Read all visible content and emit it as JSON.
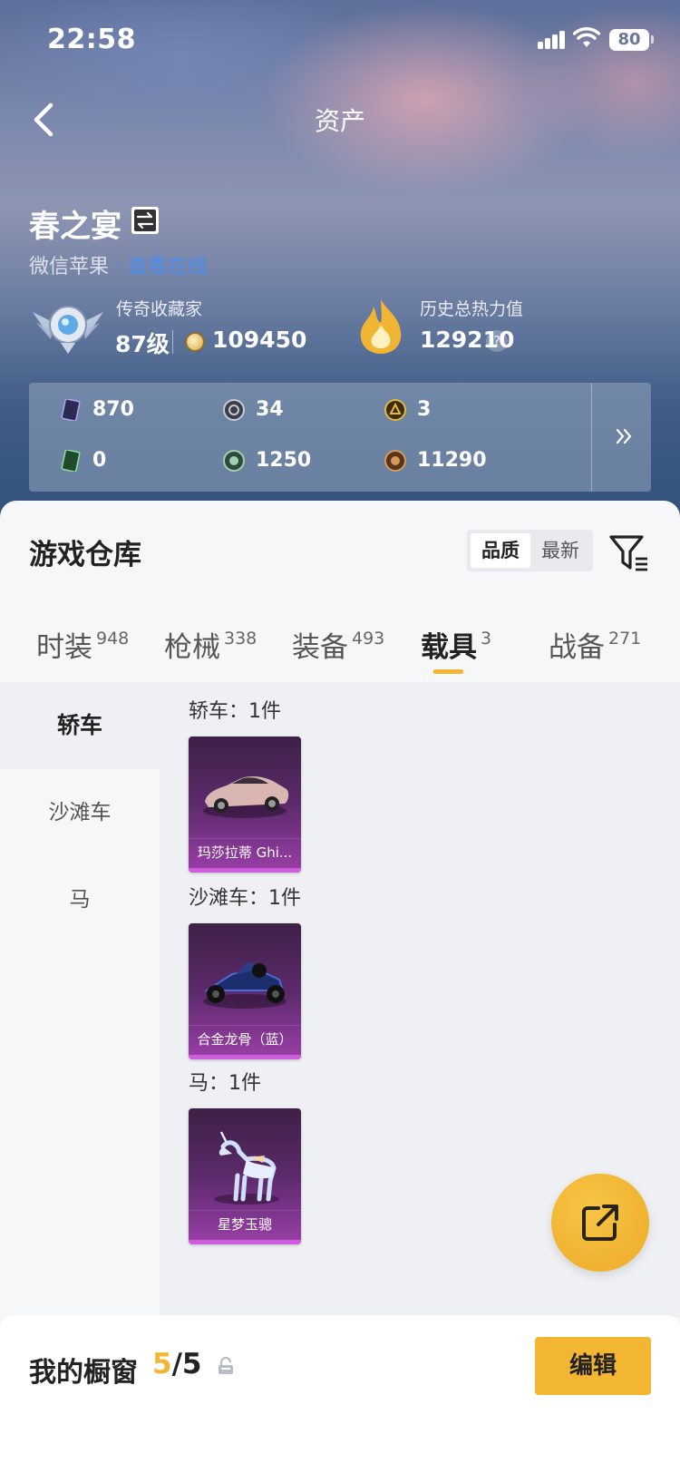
{
  "status_bar": {
    "time": "22:58",
    "battery": "80"
  },
  "nav": {
    "title": "资产"
  },
  "profile": {
    "name": "春之宴",
    "platform": "微信苹果",
    "platform_link": "· 查看在线",
    "collector_title": "传奇收藏家",
    "level": "87级",
    "points": "109450",
    "heat_title": "历史总热力值",
    "heat_value": "129210",
    "help": "?"
  },
  "currencies": [
    {
      "icon": "purple-card-icon",
      "value": "870"
    },
    {
      "icon": "silver-coin-icon",
      "value": "34"
    },
    {
      "icon": "gold-medal-icon",
      "value": "3"
    },
    {
      "icon": "green-card-icon",
      "value": "0"
    },
    {
      "icon": "green-coin-icon",
      "value": "1250"
    },
    {
      "icon": "bronze-coin-icon",
      "value": "11290"
    }
  ],
  "warehouse": {
    "title": "游戏仓库",
    "sort_options": [
      "品质",
      "最新"
    ],
    "tabs": [
      {
        "label": "时装",
        "count": "948"
      },
      {
        "label": "枪械",
        "count": "338"
      },
      {
        "label": "装备",
        "count": "493"
      },
      {
        "label": "载具",
        "count": "3"
      },
      {
        "label": "战备",
        "count": "271"
      }
    ],
    "categories": [
      "轿车",
      "沙滩车",
      "马"
    ],
    "groups": [
      {
        "title": "轿车：1件",
        "item": "玛莎拉蒂 Ghi..."
      },
      {
        "title": "沙滩车：1件",
        "item": "合金龙骨（蓝）"
      },
      {
        "title": "马：1件",
        "item": "星梦玉骢"
      }
    ]
  },
  "showcase": {
    "label": "我的橱窗",
    "current": "5",
    "total": "/5",
    "edit": "编辑"
  },
  "colors": {
    "accent": "#f2b632",
    "card_purple": "#9a3fa8",
    "link": "#4a8df0"
  }
}
